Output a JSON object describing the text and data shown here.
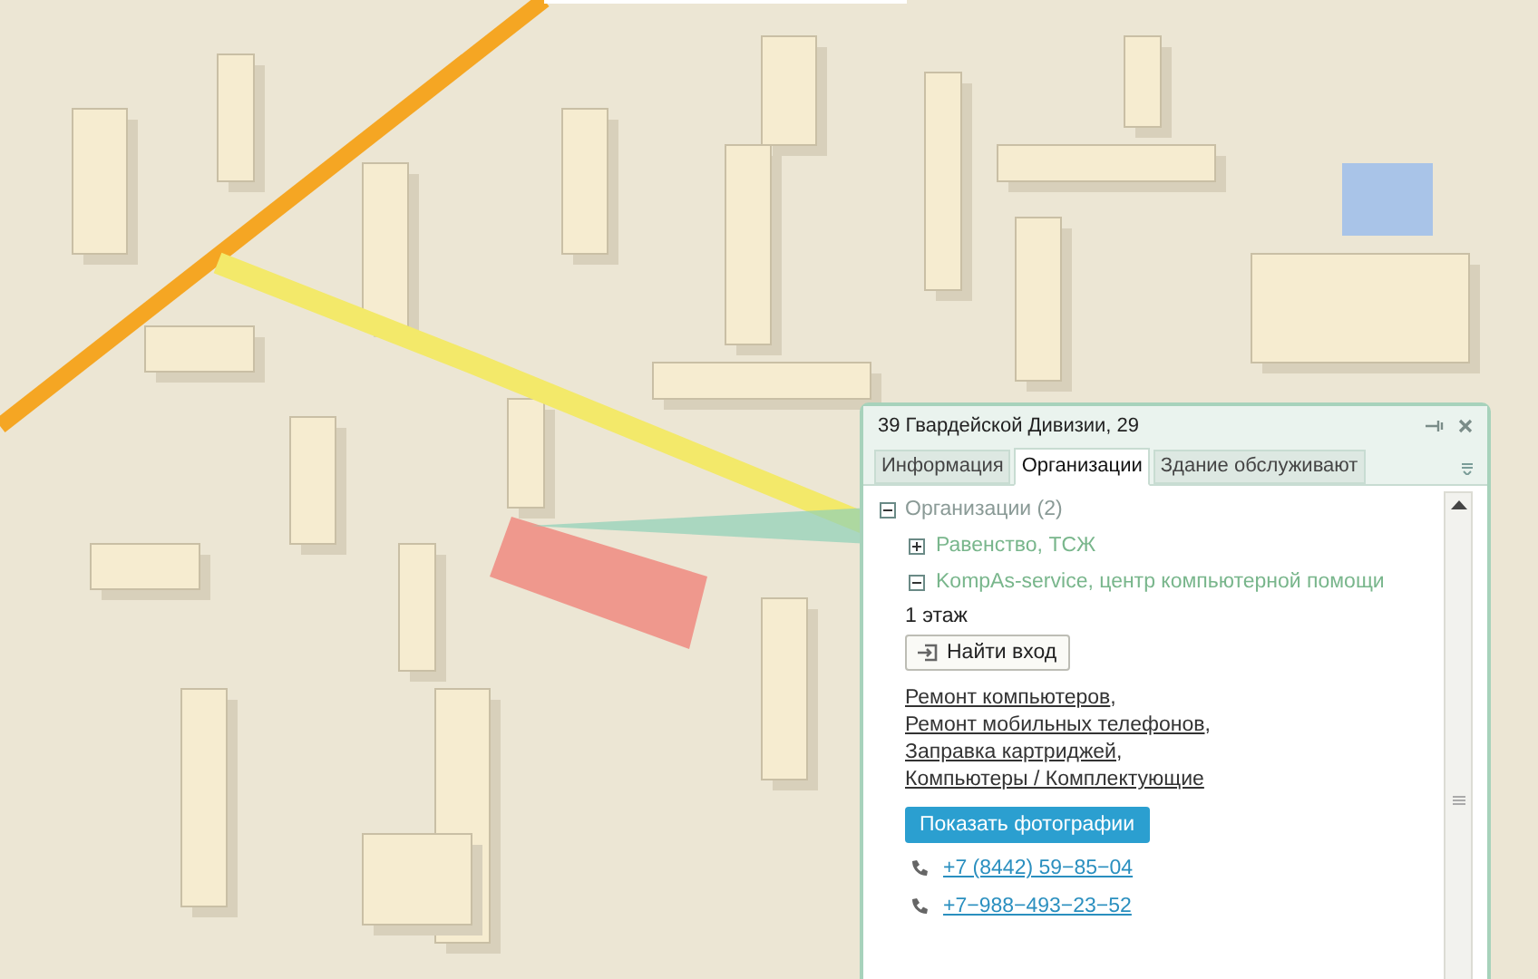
{
  "popup": {
    "title": "39 Гвардейской Дивизии, 29",
    "tabs": [
      {
        "label": "Информация",
        "selected": false
      },
      {
        "label": "Организации",
        "selected": true
      },
      {
        "label": "Здание обслуживают",
        "selected": false
      }
    ],
    "tree": {
      "label": "Организации (2)",
      "expanded": true,
      "children": [
        {
          "label": "Равенство, ТСЖ",
          "expanded": false
        },
        {
          "label": "KompAs-service, центр компьютерной помощи",
          "expanded": true,
          "floor": "1 этаж",
          "entrance_button": "Найти вход",
          "categories": [
            {
              "text": "Ремонт компьютеров",
              "sep": ","
            },
            {
              "text": "Ремонт мобильных телефонов",
              "sep": ","
            },
            {
              "text": "Заправка картриджей",
              "sep": ","
            },
            {
              "text": "Компьютеры / Комплектующие"
            }
          ],
          "photos_button": "Показать фотографии",
          "phones": [
            "+7 (8442) 59−85−04",
            "+7−988−493−23−52"
          ]
        }
      ]
    }
  }
}
